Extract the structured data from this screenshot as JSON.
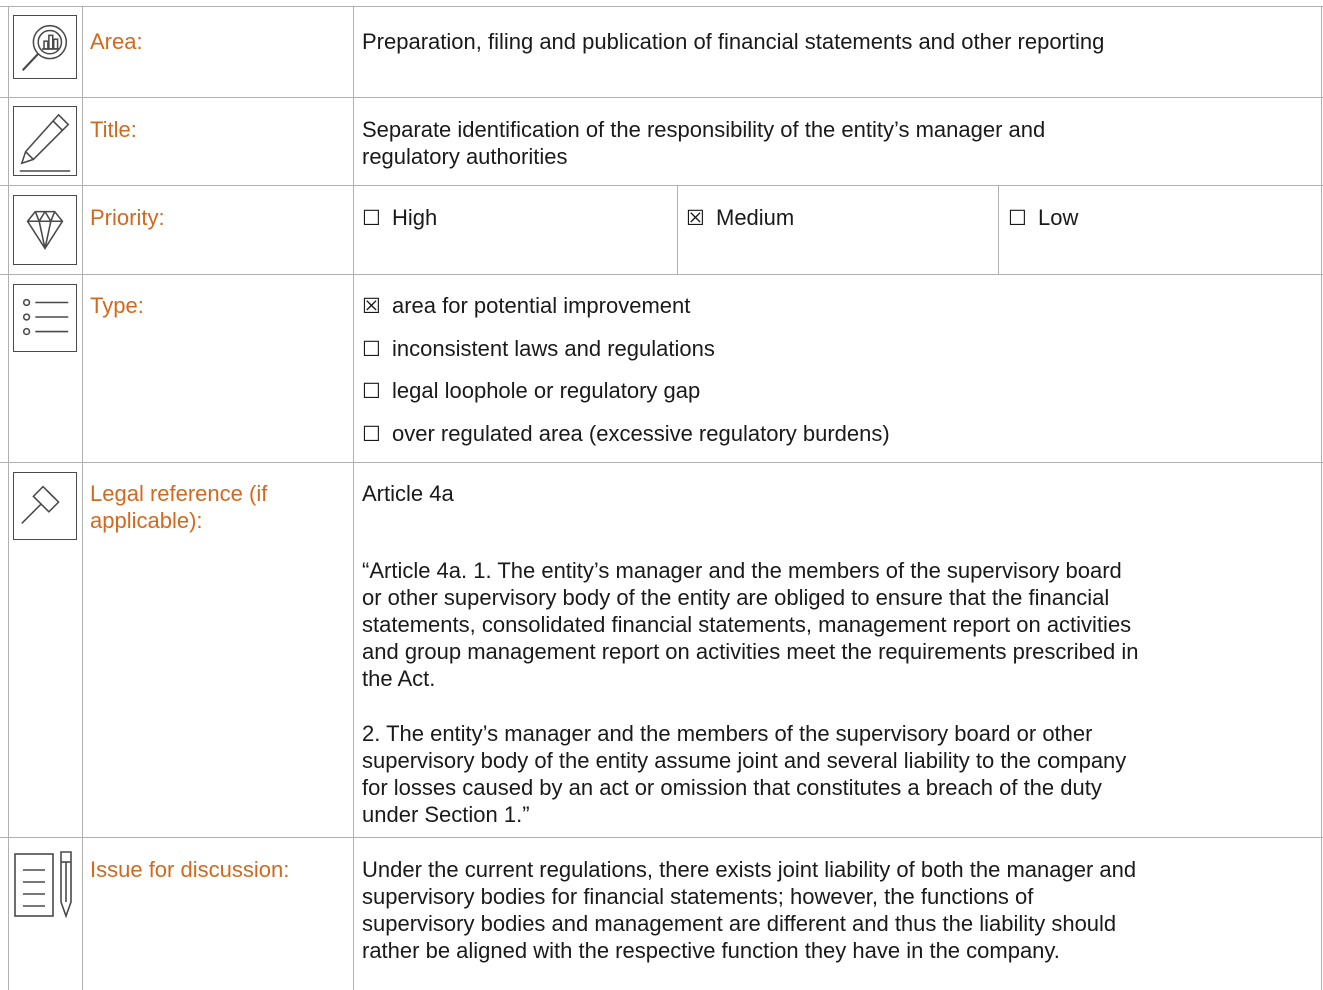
{
  "rows": {
    "area": {
      "label": "Area:",
      "value": "Preparation, filing and publication of financial statements and other reporting",
      "icon": "chart-magnifier-icon"
    },
    "title": {
      "label": "Title:",
      "value_line1": "Separate identification of the responsibility of the entity’s manager and",
      "value_line2": "regulatory authorities",
      "icon": "pencil-icon"
    },
    "priority": {
      "label": "Priority:",
      "icon": "diamond-icon",
      "options": [
        {
          "mark": "☐",
          "text": "High"
        },
        {
          "mark": "☒",
          "text": "Medium"
        },
        {
          "mark": "☐",
          "text": "Low"
        }
      ]
    },
    "type": {
      "label": "Type:",
      "icon": "list-icon",
      "options": [
        {
          "mark": "☒",
          "text": "area for potential improvement"
        },
        {
          "mark": "☐",
          "text": "inconsistent laws and regulations"
        },
        {
          "mark": "☐",
          "text": "legal loophole or regulatory gap"
        },
        {
          "mark": "☐",
          "text": "over regulated area (excessive regulatory burdens)"
        }
      ]
    },
    "legal": {
      "label_line1": "Legal reference (if",
      "label_line2": "applicable):",
      "icon": "gavel-icon",
      "heading": "Article 4a",
      "para1": [
        "“Article 4a. 1. The entity’s manager and the members of the supervisory board",
        "or other supervisory body of the entity are obliged to ensure that the financial",
        "statements, consolidated financial statements, management report on activities",
        "and group management report on activities meet the requirements prescribed in",
        "the Act."
      ],
      "para2": [
        "2. The entity’s manager and the members of the supervisory board or other",
        "supervisory body of the entity assume joint and several liability to the company",
        "for losses caused by an act or omission that constitutes a breach of the duty",
        "under Section 1.”"
      ]
    },
    "issue": {
      "label": "Issue for discussion:",
      "icon": "document-pen-icon",
      "lines": [
        "Under the current regulations, there exists joint liability of both the manager and",
        "supervisory bodies for financial statements; however, the functions of",
        "supervisory bodies and management are different and thus the liability should",
        "rather be aligned with the respective function they have in the company."
      ]
    }
  }
}
